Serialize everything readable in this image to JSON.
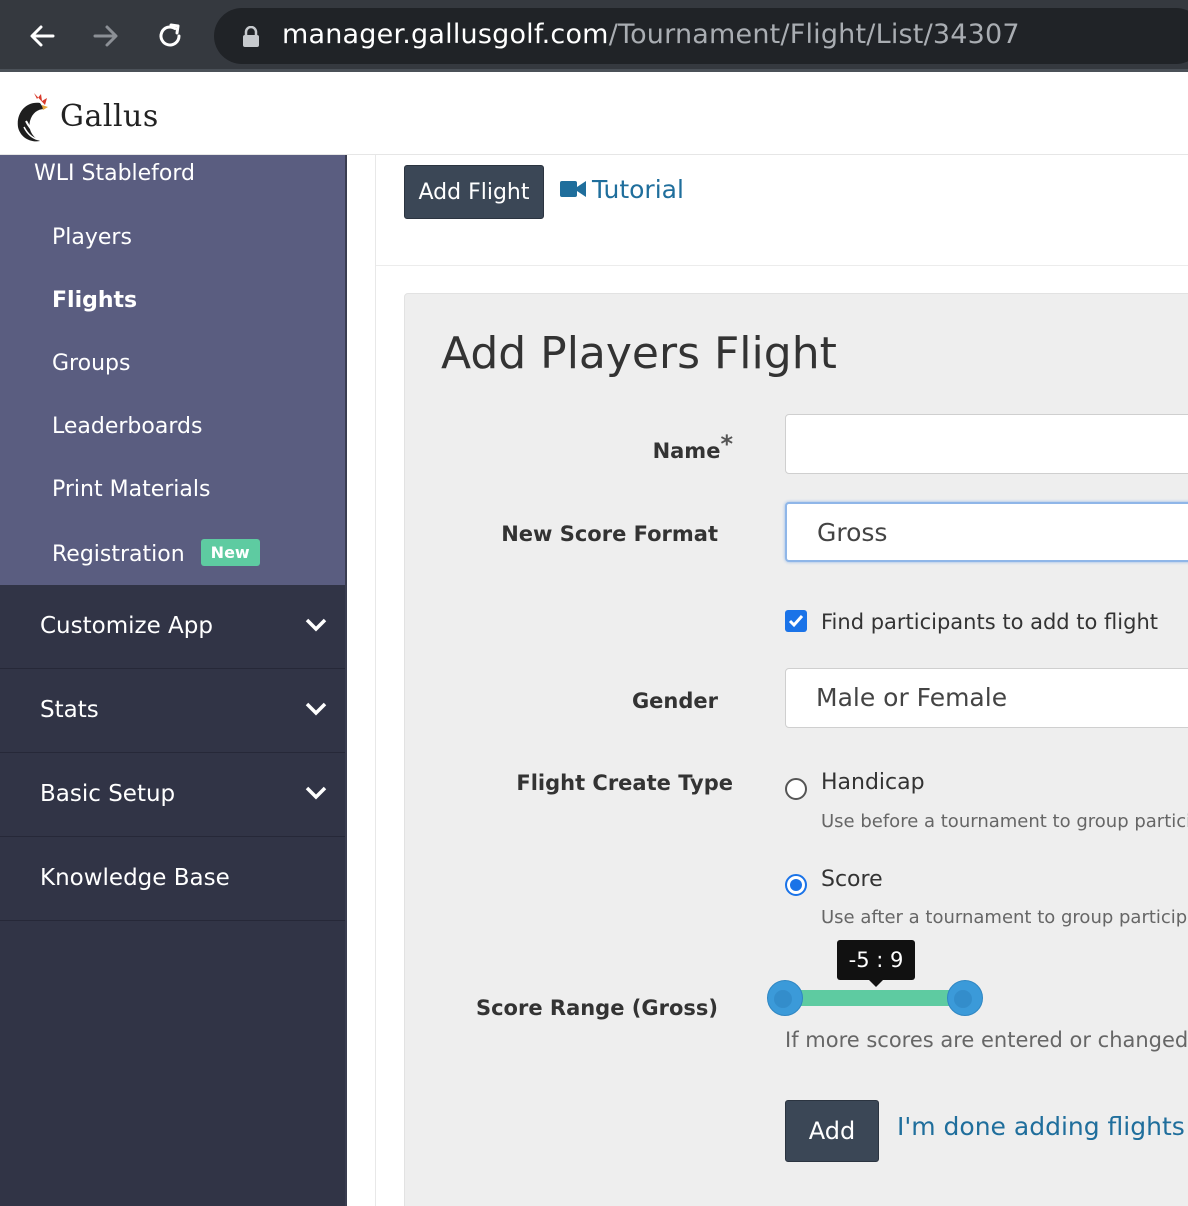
{
  "browser": {
    "url_host": "manager.gallusgolf.com",
    "url_path": "/Tournament/Flight/List/34307",
    "back_icon": "arrow-left-icon",
    "forward_icon": "arrow-right-icon",
    "reload_icon": "reload-icon",
    "lock_icon": "lock-icon"
  },
  "brand": {
    "name": "Gallus",
    "logo_icon": "rooster-logo-icon"
  },
  "sidebar": {
    "tournament_name": "WLI Stableford",
    "items": [
      {
        "label": "Players",
        "active": false
      },
      {
        "label": "Flights",
        "active": true
      },
      {
        "label": "Groups",
        "active": false
      },
      {
        "label": "Leaderboards",
        "active": false
      },
      {
        "label": "Print Materials",
        "active": false
      },
      {
        "label": "Registration",
        "active": false,
        "badge": "New"
      }
    ],
    "sections": [
      {
        "label": "Customize App",
        "expandable": true
      },
      {
        "label": "Stats",
        "expandable": true
      },
      {
        "label": "Basic Setup",
        "expandable": true
      },
      {
        "label": "Knowledge Base",
        "expandable": false
      }
    ]
  },
  "toolbar": {
    "add_flight_label": "Add Flight",
    "tutorial_label": "Tutorial",
    "tutorial_icon": "video-camera-icon"
  },
  "form": {
    "title": "Add Players Flight",
    "name_label": "Name",
    "name_required_mark": "*",
    "name_value": "",
    "score_format_label": "New Score Format",
    "score_format_value": "Gross",
    "find_participants_label": "Find participants to add to flight",
    "find_participants_checked": true,
    "gender_label": "Gender",
    "gender_value": "Male or Female",
    "create_type_label": "Flight Create Type",
    "create_type_options": [
      {
        "label": "Handicap",
        "help": "Use before a tournament to group participa",
        "selected": false
      },
      {
        "label": "Score",
        "help": "Use after a tournament to group participan",
        "selected": true
      }
    ],
    "score_range_label": "Score Range (Gross)",
    "score_range_tooltip": "-5 : 9",
    "score_range_min": -5,
    "score_range_max": 9,
    "score_range_help": "If more scores are entered or changed fo",
    "add_label": "Add",
    "done_label": "I'm done adding flights"
  },
  "colors": {
    "sidebar_bg": "#313446",
    "submenu_bg": "#5a5d80",
    "badge_bg": "#5ecba1",
    "button_bg": "#3b4756",
    "link": "#1f6e9c",
    "slider_track": "#5ecba1",
    "slider_handle": "#3b9ad9",
    "checkbox": "#1a73e8"
  }
}
